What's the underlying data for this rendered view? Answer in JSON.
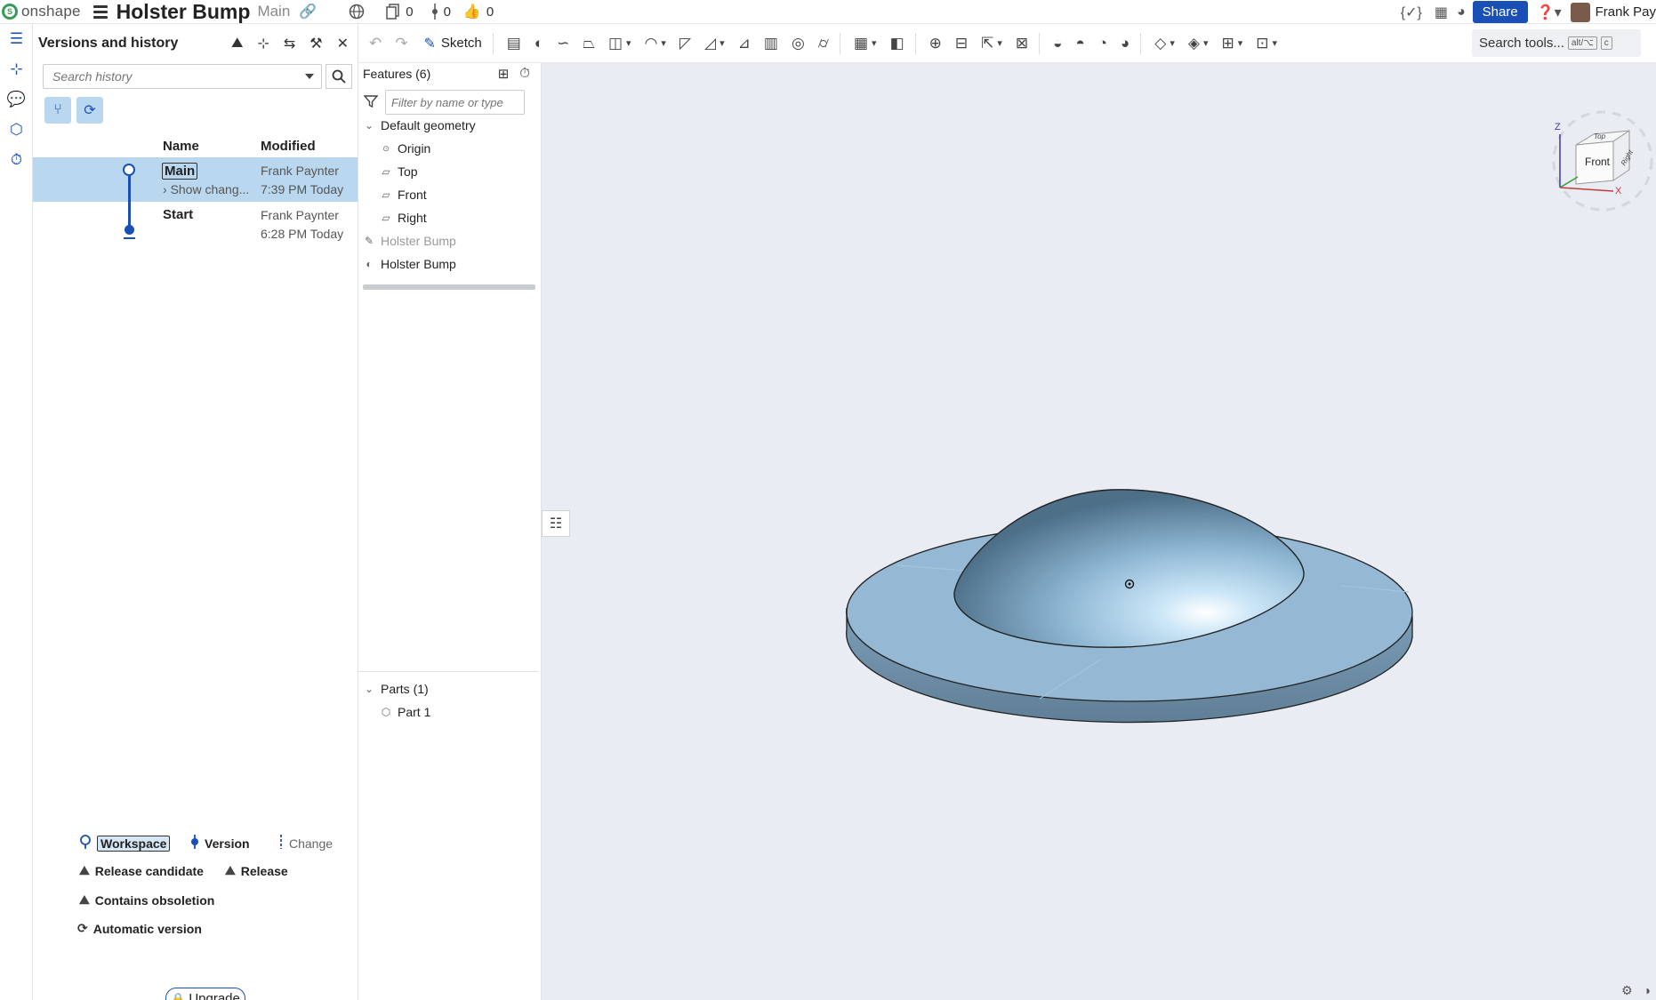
{
  "app": {
    "brand": "onshape",
    "doc_title": "Holster Bump",
    "branch": "Main",
    "counts": {
      "copies": "0",
      "versions": "0",
      "likes": "0"
    },
    "share_label": "Share",
    "user_name": "Frank Pay"
  },
  "history_panel": {
    "title": "Versions and history",
    "search_placeholder": "Search history",
    "columns": {
      "name": "Name",
      "modified": "Modified"
    },
    "rows": [
      {
        "name": "Main",
        "sub": "Show chang...",
        "author": "Frank Paynter",
        "time": "7:39 PM Today"
      },
      {
        "name": "Start",
        "sub": "",
        "author": "Frank Paynter",
        "time": "6:28 PM Today"
      }
    ],
    "legend": {
      "workspace": "Workspace",
      "version": "Version",
      "change": "Change",
      "release_candidate": "Release candidate",
      "release": "Release",
      "obsoletion": "Contains obsoletion",
      "automatic": "Automatic version"
    },
    "upgrade_label": "Upgrade"
  },
  "toolbar": {
    "sketch_label": "Sketch",
    "search_label": "Search tools...",
    "search_kbd_1": "alt/⌥",
    "search_kbd_2": "c"
  },
  "feature_tree": {
    "title": "Features (6)",
    "filter_placeholder": "Filter by name or type",
    "default_geometry": "Default geometry",
    "origin": "Origin",
    "planes": [
      "Top",
      "Front",
      "Right"
    ],
    "sketch": "Holster Bump",
    "feature": "Holster Bump",
    "parts_title": "Parts (1)",
    "part": "Part 1"
  },
  "viewcube": {
    "front": "Front",
    "top": "Top",
    "right": "Right",
    "axis_x": "X",
    "axis_z": "Z"
  },
  "colors": {
    "accent": "#1a50b5",
    "selection": "#b9d8f0",
    "viewport_bg": "#e9ecf2",
    "part_fill": "#8fb6d4"
  }
}
